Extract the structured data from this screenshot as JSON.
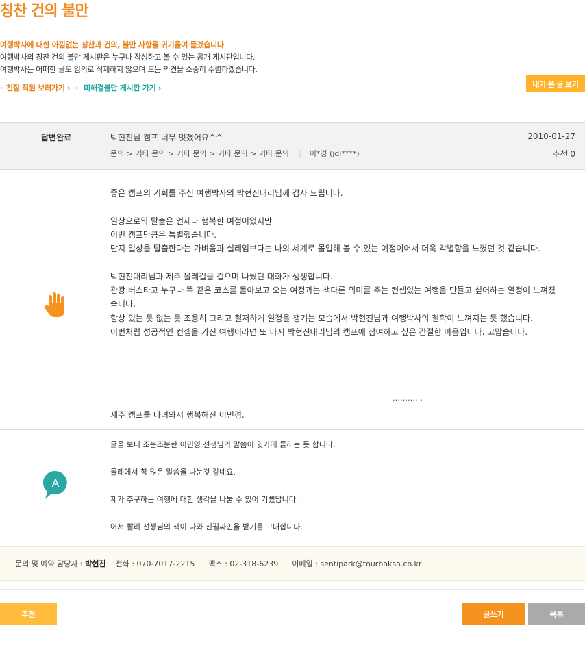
{
  "page": {
    "title": "칭찬 건의 불만"
  },
  "intro": {
    "highlight": "여행박사에 대한 아낌없는 칭찬과 건의, 불만 사항을 귀기울여 듣겠습니다",
    "line1": "여행박사의 칭찬 건의 불만 게시판은 누구나 작성하고 볼 수 있는 공개 게시판입니다.",
    "line2": "여행박사는 어떠한 글도 임의로 삭제하지 않으며 모든 의견을 소중히 수렴하겠습니다."
  },
  "links": {
    "bullet": "·",
    "kind_staff": "친절 직원 보러가기 ›",
    "separator": "·",
    "unresolved": "미해결불만 게시판 가기 ›"
  },
  "toolbar": {
    "my_posts_label": "내가 쓴 글 보기"
  },
  "post": {
    "status": "답변완료",
    "subject": "박현진님 캠프 너무 멋졌어요^^",
    "date": "2010-01-27",
    "categories": "문의 > 기타 문의 > 기타 문의 > 기타 문의 > 기타 문의",
    "author_separator": "|",
    "author": "이*경 (jdi****)",
    "recommend": "추천 0"
  },
  "question": {
    "lines": [
      "좋은 캠프의 기회를 주신 여행박사의 박현진대리님께 감사 드립니다.",
      "",
      "일상으로의 탈출은 언제나 행복한 여정이었지만",
      "이번 캠프만큼은 특별했습니다.",
      "단지 일상을 탈출한다는 가벼움과 설레임보다는 나의 세계로 몰입해 볼 수 있는 여정이어서 더욱 각별함을 느꼈던 것 같습니다.",
      "",
      "박현진대리님과 제주 올레길을 걸으며 나눴던 대화가 생생합니다.",
      "관광 버스타고 누구나 똑 같은 코스를 돌아보고 오는 여정과는 색다른 의미를 주는 컨셉있는 여행을 만들고 싶어하는 열정이 느껴졌습니다.",
      "항상 있는 듯 없는 듯 조용히 그리고 철저하게 일정을 챙기는 모습에서 박현진님과 여행박사의 철학이 느껴지는 듯 했습니다.",
      "이번처럼 성공적인 컨셉을 가진 여행이라면 또 다시 박현진대리님의 캠프에 참여하고 싶은 간절한 마음입니다. 고맙습니다."
    ],
    "dots": "…………",
    "signature": "제주 캠프를 다녀와서 행복해진 이민경."
  },
  "answer": {
    "icon_letter": "A",
    "lines": [
      "글을 보니 조분조분한 이민영 선생님의 말씀이 귓가에 들리는 듯 합니다.",
      "",
      "올레에서 참 많은 말씀을 나눈것 같네요.",
      "",
      "제가 추구하는 여행에 대한 생각을 나눌 수 있어 기뻤답니다.",
      "",
      "어서 빨리 선생님의 책이 나와 친필싸인을 받기를 고대합니다."
    ]
  },
  "contact": {
    "label": "문의 및 예약 담당자 :",
    "name": "박현진",
    "phone": "전화 : 070-7017-2215",
    "fax": "팩스 : 02-318-6239",
    "email": "이메일 : sentipark@tourbaksa.co.kr"
  },
  "buttons": {
    "recommend": "추천",
    "write": "글쓰기",
    "list": "목록"
  },
  "colors": {
    "accent_orange": "#f0891e",
    "teal": "#25a8a5",
    "gray_button": "#aaaaaa"
  }
}
